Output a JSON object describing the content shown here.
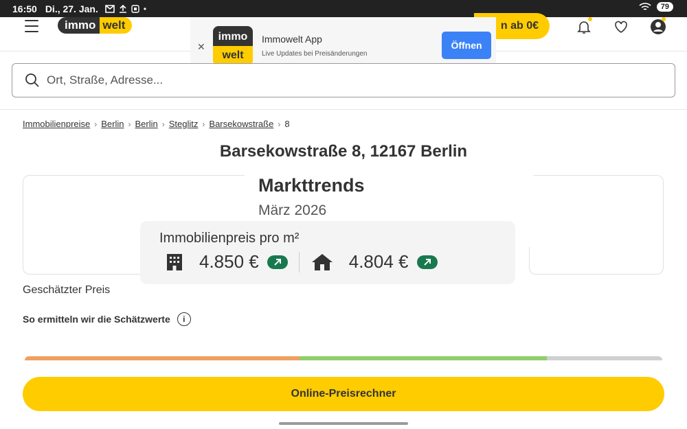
{
  "status_bar": {
    "time": "16:50",
    "date": "Di., 27. Jan.",
    "battery": "79"
  },
  "header": {
    "logo_left": "immo",
    "logo_right": "welt",
    "cta_text": "n ab 0€"
  },
  "app_banner": {
    "logo_top": "immo",
    "logo_bottom": "welt",
    "title": "Immowelt App",
    "subtitle": "Live Updates bei Preisänderungen",
    "open_label": "Öffnen"
  },
  "search": {
    "placeholder": "Ort, Straße, Adresse..."
  },
  "breadcrumb": [
    "Immobilienpreise",
    "Berlin",
    "Berlin",
    "Steglitz",
    "Barsekowstraße",
    "8"
  ],
  "page_title": "Barsekowstraße 8, 12167 Berlin",
  "market_trends": {
    "title": "Markttrends",
    "period": "März 2026",
    "price_label": "Immobilienpreis pro m²",
    "apartment_price": "4.850 €",
    "house_price": "4.804 €"
  },
  "estimate_label": "Geschätzter Preis",
  "method_label": "So ermitteln wir die Schätzwerte",
  "cta_bottom": "Online-Preisrechner",
  "colors": {
    "brand_yellow": "#ffcc00",
    "brand_dark": "#333333",
    "trend_green": "#18794e",
    "button_blue": "#3b82f6"
  }
}
